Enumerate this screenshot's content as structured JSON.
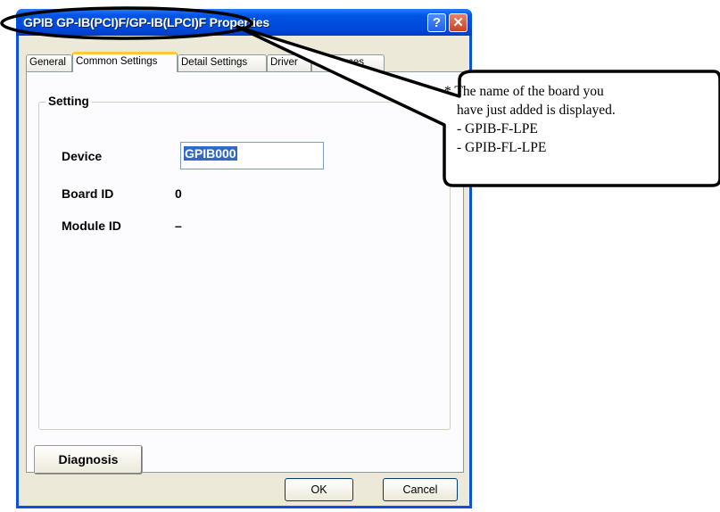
{
  "window": {
    "title": "GPIB GP-IB(PCI)F/GP-IB(LPCI)F Properties",
    "help_glyph": "?",
    "close_glyph": "✕"
  },
  "tabs": [
    {
      "label": "General",
      "active": false
    },
    {
      "label": "Common Settings",
      "active": true
    },
    {
      "label": "Detail Settings",
      "active": false
    },
    {
      "label": "Driver",
      "active": false
    },
    {
      "label": "Resources",
      "active": false
    }
  ],
  "setting_group": {
    "title": "Setting",
    "device_label": "Device",
    "device_value": "GPIB000",
    "board_id_label": "Board ID",
    "board_id_value": "0",
    "module_id_label": "Module ID",
    "module_id_value": "–"
  },
  "buttons": {
    "diagnosis": "Diagnosis",
    "ok": "OK",
    "cancel": "Cancel"
  },
  "callout": {
    "line1": "* The name of the board you",
    "line2": "have just added is displayed.",
    "line3": "- GPIB-F-LPE",
    "line4": "- GPIB-FL-LPE"
  },
  "colors": {
    "titlebar": "#0054e3",
    "dialog_bg": "#ece9d8",
    "selection": "#316ac5",
    "tab_highlight": "#ffc83c"
  }
}
